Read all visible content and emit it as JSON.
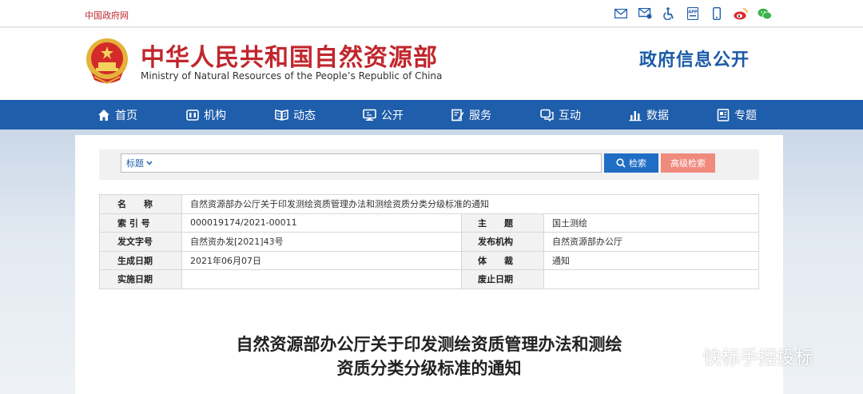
{
  "topbar": {
    "gov_link": "中国政府网",
    "icons": [
      "email-icon",
      "message-icon",
      "accessibility-icon",
      "app-icon",
      "mobile-icon",
      "weibo-icon",
      "wechat-icon"
    ]
  },
  "header": {
    "site_name_cn": "中华人民共和国自然资源部",
    "site_name_en": "Ministry of Natural Resources of the People’s Republic of China",
    "section_title": "政府信息公开"
  },
  "nav": {
    "items": [
      {
        "label": "首页",
        "icon": "home-icon"
      },
      {
        "label": "机构",
        "icon": "org-icon"
      },
      {
        "label": "动态",
        "icon": "book-icon"
      },
      {
        "label": "公开",
        "icon": "monitor-icon"
      },
      {
        "label": "服务",
        "icon": "edit-icon"
      },
      {
        "label": "互动",
        "icon": "chat-icon"
      },
      {
        "label": "数据",
        "icon": "bar-chart-icon"
      },
      {
        "label": "专题",
        "icon": "document-icon"
      }
    ]
  },
  "search": {
    "field_select": "标题",
    "placeholder": "",
    "search_button": "检索",
    "advanced_button": "高级检索"
  },
  "meta": {
    "name_label": "名　　称",
    "name_value": "自然资源部办公厅关于印发测绘资质管理办法和测绘资质分类分级标准的通知",
    "index_label": "索 引 号",
    "index_value": "000019174/2021-00011",
    "subject_label": "主　　题",
    "subject_value": "国土测绘",
    "docno_label": "发文字号",
    "docno_value": "自然资办发[2021]43号",
    "issuer_label": "发布机构",
    "issuer_value": "自然资源部办公厅",
    "created_label": "生成日期",
    "created_value": "2021年06月07日",
    "genre_label": "体　　裁",
    "genre_value": "通知",
    "effective_label": "实施日期",
    "effective_value": "",
    "expired_label": "废止日期",
    "expired_value": ""
  },
  "document": {
    "title_line1": "自然资源部办公厅关于印发测绘资质管理办法和测绘",
    "title_line2": "资质分类分级标准的通知"
  },
  "watermark": {
    "text": "快标手招投标"
  },
  "colors": {
    "brand_red": "#c0272d",
    "nav_blue": "#1f5eab",
    "search_blue": "#1f6dc4",
    "advanced_pink": "#f08a7d"
  }
}
